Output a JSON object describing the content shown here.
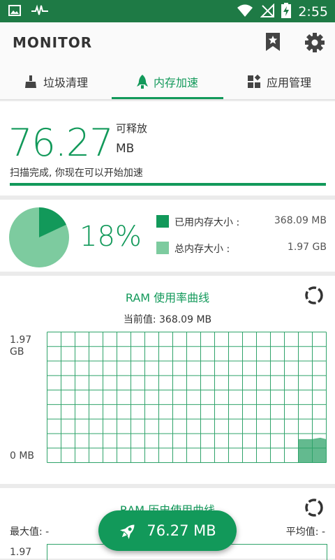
{
  "status_bar": {
    "time": "2:55",
    "icons": [
      "image-icon",
      "pulse-icon",
      "wifi-icon",
      "signal-off-icon",
      "battery-charging-icon"
    ]
  },
  "app": {
    "title": "MONITOR",
    "icons": [
      "bookmark-star-icon",
      "gear-icon"
    ]
  },
  "tabs": [
    {
      "label": "垃圾清理",
      "icon": "broom-icon",
      "active": false
    },
    {
      "label": "内存加速",
      "icon": "rocket-icon",
      "active": true
    },
    {
      "label": "应用管理",
      "icon": "apps-icon",
      "active": false
    }
  ],
  "release": {
    "amount": "76.27",
    "label": "可释放",
    "unit": "MB",
    "message": "扫描完成, 你现在可以开始加速",
    "progress": 1.0
  },
  "memory": {
    "percent_text": "18%",
    "used_fraction": 0.18,
    "used_label": "已用内存大小 :",
    "used_value": "368.09 MB",
    "total_label": "总内存大小 :",
    "total_value": "1.97 GB",
    "used_color": "#12995a",
    "total_color": "#7dcb9f"
  },
  "ram_chart": {
    "title": "RAM 使用率曲线",
    "current": "当前值: 368.09 MB",
    "y_max_label": "1.97\nGB",
    "y_min_label": "0 MB",
    "grid_cols": 20,
    "grid_rows": 9,
    "usage_fraction": 0.18,
    "refresh_icon": "refresh-icon"
  },
  "history_chart": {
    "title": "RAM 历史使用曲线",
    "max_label": "最大值: -",
    "avg_label": "平均值: -",
    "y_max_label": "1.97",
    "refresh_icon": "refresh-icon"
  },
  "fab": {
    "label": "76.27 MB",
    "icon": "rocket-icon"
  },
  "colors": {
    "accent": "#12995a",
    "status_bar": "#1e7a45",
    "grid": "#2fa36a"
  }
}
